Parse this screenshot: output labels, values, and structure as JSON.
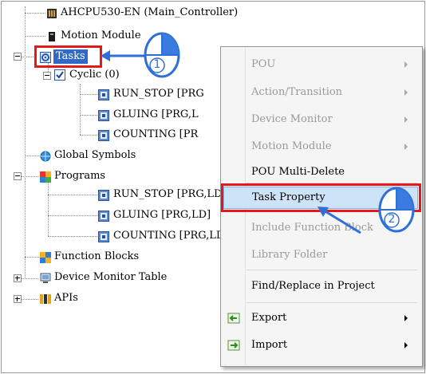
{
  "tree": {
    "nodes": [
      {
        "id": "ahcpu",
        "label": "AHCPU530-EN  (Main_Controller)",
        "icon": "controller-icon"
      },
      {
        "id": "motion",
        "label": "Motion Module",
        "icon": "module-icon"
      },
      {
        "id": "tasks",
        "label": "Tasks",
        "icon": "gear-icon"
      },
      {
        "id": "cyclic",
        "label": "Cyclic (0)",
        "icon": "checkbox-icon"
      },
      {
        "id": "run_stop_task",
        "label": "RUN_STOP [PRG",
        "icon": "pou-icon"
      },
      {
        "id": "gluing_task",
        "label": "GLUING [PRG,L",
        "icon": "pou-icon"
      },
      {
        "id": "counting_task",
        "label": "COUNTING [PR",
        "icon": "pou-icon"
      },
      {
        "id": "global_symbols",
        "label": "Global Symbols",
        "icon": "globe-icon"
      },
      {
        "id": "programs",
        "label": "Programs",
        "icon": "programs-icon"
      },
      {
        "id": "run_stop_prg",
        "label": "RUN_STOP [PRG,LD",
        "icon": "pou-icon"
      },
      {
        "id": "gluing_prg",
        "label": "GLUING [PRG,LD]",
        "icon": "pou-icon"
      },
      {
        "id": "counting_prg",
        "label": "COUNTING [PRG,LD",
        "icon": "pou-icon"
      },
      {
        "id": "function_blocks",
        "label": "Function Blocks",
        "icon": "function-blocks-icon"
      },
      {
        "id": "device_monitor",
        "label": "Device Monitor Table",
        "icon": "monitor-icon"
      },
      {
        "id": "apis",
        "label": "APIs",
        "icon": "api-icon"
      }
    ]
  },
  "context_menu": {
    "items": [
      {
        "label": "POU",
        "enabled": false,
        "submenu": true
      },
      {
        "label": "Action/Transition",
        "enabled": false,
        "submenu": true
      },
      {
        "label": "Device Monitor",
        "enabled": false,
        "submenu": true
      },
      {
        "label": "Motion Module",
        "enabled": false,
        "submenu": true
      },
      {
        "label": "POU Multi-Delete",
        "enabled": true,
        "submenu": false
      },
      {
        "label": "Task Property",
        "enabled": true,
        "submenu": false,
        "highlighted": true
      },
      {
        "label": "Include Function Block",
        "enabled": false,
        "submenu": false
      },
      {
        "label": "Library Folder",
        "enabled": false,
        "submenu": false
      },
      {
        "label": "Find/Replace in Project",
        "enabled": true,
        "submenu": false
      },
      {
        "label": "Export",
        "enabled": true,
        "submenu": true,
        "icon": "export-icon"
      },
      {
        "label": "Import",
        "enabled": true,
        "submenu": true,
        "icon": "import-icon"
      }
    ]
  },
  "annotations": {
    "step1": "1",
    "step2": "2"
  },
  "colors": {
    "highlight_red": "#e3191b",
    "callout_blue": "#2f6fd6",
    "menu_highlight": "#cfe3f8"
  }
}
